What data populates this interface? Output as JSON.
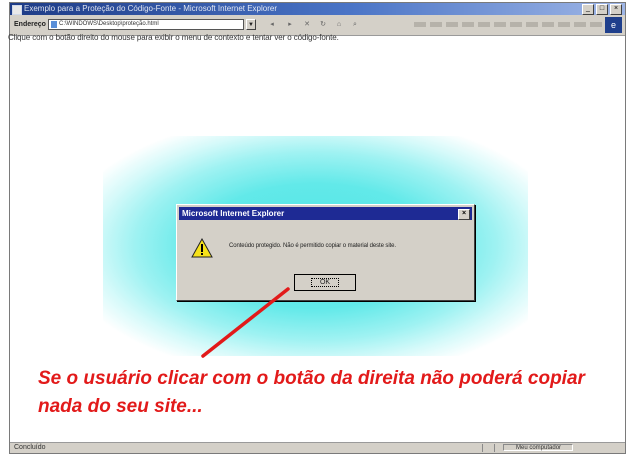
{
  "window": {
    "title": "Exemplo para a Proteção do Código-Fonte - Microsoft Internet Explorer",
    "controls": [
      "_",
      "□",
      "×"
    ]
  },
  "toolbar": {
    "address_label": "Endereço",
    "address_value": "C:\\WINDOWS\\Desktop\\proteção.html",
    "dropdown_glyph": "▼",
    "ie_logo": "e"
  },
  "page": {
    "text": "Clique com o botão direito do mouse para exibir o menu de contexto e tentar ver o código-fonte."
  },
  "dialog": {
    "title": "Microsoft Internet Explorer",
    "close_glyph": "×",
    "message": "Conteúdo protegido. Não é permitido copiar o material deste site.",
    "ok_label": "OK",
    "icon": "warning-icon"
  },
  "caption": {
    "text": "Se o usuário clicar com o botão da direita não poderá copiar nada do seu site...",
    "color": "#e21a1a"
  },
  "status": {
    "left": "Concluído",
    "zone": "Meu computador"
  },
  "colors": {
    "glow": "#4fe5e5",
    "dialog_title": "#1e2a94",
    "arrow": "#e21a1a"
  }
}
